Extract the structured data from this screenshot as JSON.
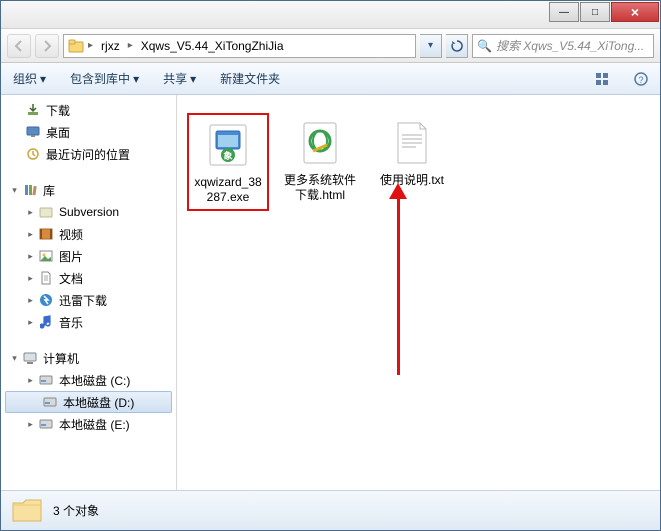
{
  "window": {
    "min": "—",
    "max": "□",
    "close": "×"
  },
  "breadcrumb": {
    "part1": "rjxz",
    "part2": "Xqws_V5.44_XiTongZhiJia"
  },
  "search": {
    "placeholder": "搜索 Xqws_V5.44_XiTong..."
  },
  "toolbar": {
    "organize": "组织",
    "include": "包含到库中",
    "share": "共享",
    "newfolder": "新建文件夹"
  },
  "tree": {
    "downloads": "下载",
    "desktop": "桌面",
    "recent": "最近访问的位置",
    "library": "库",
    "subversion": "Subversion",
    "video": "视频",
    "pictures": "图片",
    "documents": "文档",
    "xunlei": "迅雷下载",
    "music": "音乐",
    "computer": "计算机",
    "driveC": "本地磁盘 (C:)",
    "driveD": "本地磁盘 (D:)",
    "driveE": "本地磁盘 (E:)"
  },
  "files": {
    "f1": "xqwizard_38287.exe",
    "f2": "更多系统软件下载.html",
    "f3": "使用说明.txt"
  },
  "status": {
    "count": "3 个对象"
  }
}
